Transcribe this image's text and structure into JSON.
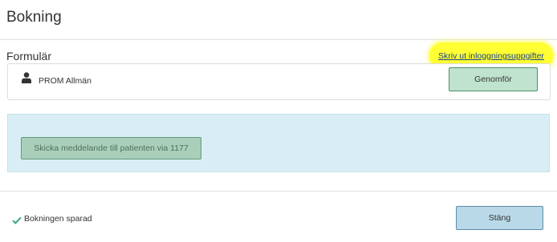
{
  "header": {
    "title": "Bokning"
  },
  "forms": {
    "section_label": "Formulär",
    "print_link": "Skriv ut inloggningsuppgifter",
    "items": [
      {
        "name": "PROM Allmän",
        "icon": "user-icon",
        "action_label": "Genomför"
      }
    ]
  },
  "notify": {
    "send_label": "Skicka meddelande till patienten via 1177"
  },
  "footer": {
    "status_icon": "checkmark-icon",
    "status_text": "Bokningen sparad",
    "close_label": "Stäng"
  },
  "colors": {
    "highlight": "#ffff33",
    "link": "#1a3f8f",
    "primary_green": "#bfe3cf",
    "info_panel": "#d9eef4",
    "close_button": "#b9d9e8",
    "check": "#3aa58a"
  }
}
